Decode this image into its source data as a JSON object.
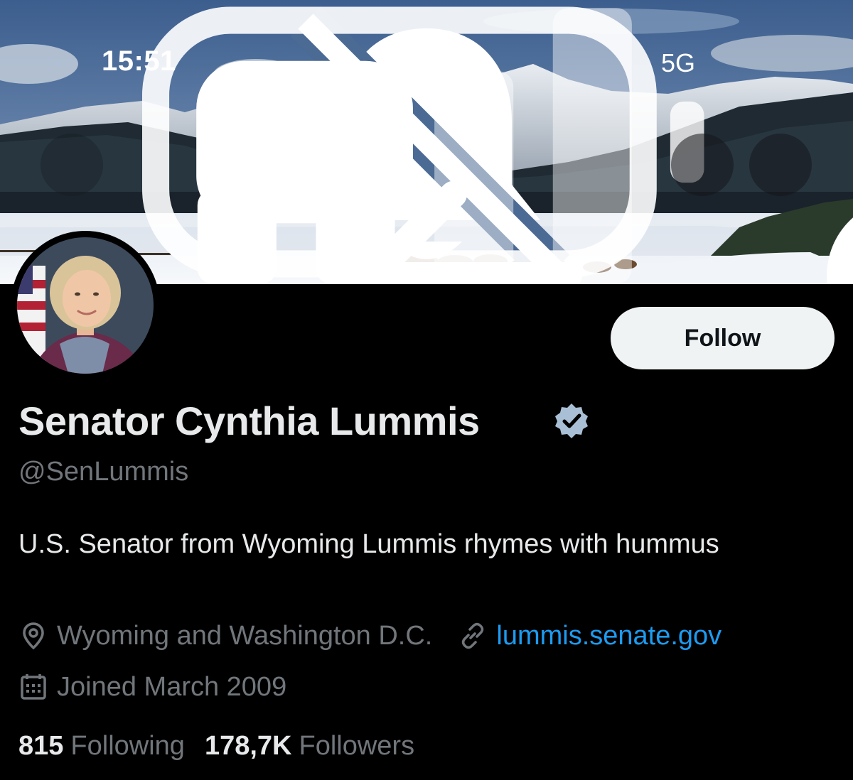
{
  "status_bar": {
    "time": "15:51",
    "network": "5G",
    "icons": [
      "bell-off-icon",
      "signal-icon",
      "battery-icon"
    ]
  },
  "header": {
    "back_icon": "arrow-left-icon",
    "search_icon": "search-icon",
    "more_icon": "more-horizontal-icon"
  },
  "profile": {
    "display_name": "Senator Cynthia Lummis",
    "handle": "@SenLummis",
    "verified": true,
    "follow_label": "Follow",
    "bio": "U.S. Senator from Wyoming Lummis rhymes with hummus",
    "location": "Wyoming and Washington D.C.",
    "website": "lummis.senate.gov",
    "joined": "Joined March 2009",
    "following_count": "815",
    "following_label": "Following",
    "followers_count": "178,7K",
    "followers_label": "Followers"
  },
  "colors": {
    "background": "#000000",
    "primary_text": "#e7e9ea",
    "secondary_text": "#71767b",
    "link": "#1d9bf0",
    "follow_button_bg": "#eff3f4",
    "verified_badge": "#a9bfd6"
  }
}
